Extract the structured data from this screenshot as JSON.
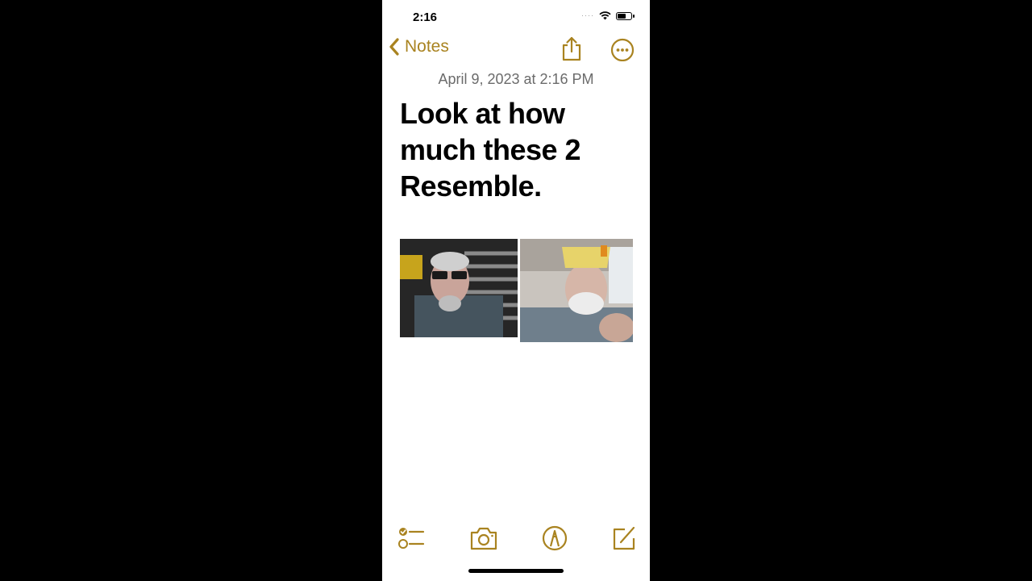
{
  "status_bar": {
    "time": "2:16",
    "signal": "····",
    "battery_level": 0.6
  },
  "nav": {
    "back_label": "Notes",
    "back_icon": "chevron-left-icon",
    "share_icon": "share-icon",
    "more_icon": "ellipsis-circle-icon"
  },
  "note": {
    "date": "April 9, 2023 at 2:16 PM",
    "title": "Look at how much these 2 Resemble.",
    "images": [
      {
        "description": "Man with glasses and gray beard in front of dark flag background"
      },
      {
        "description": "Older man with white beard wearing yellow paper crown in a car"
      }
    ]
  },
  "toolbar": {
    "items": [
      {
        "name": "checklist",
        "icon": "checklist-icon"
      },
      {
        "name": "camera",
        "icon": "camera-icon"
      },
      {
        "name": "markup",
        "icon": "markup-pen-icon"
      },
      {
        "name": "compose",
        "icon": "compose-icon"
      }
    ]
  },
  "colors": {
    "accent": "#A98320",
    "background": "#FFFFFF",
    "letterbox": "#000000",
    "date_text": "#6B6B6B"
  }
}
